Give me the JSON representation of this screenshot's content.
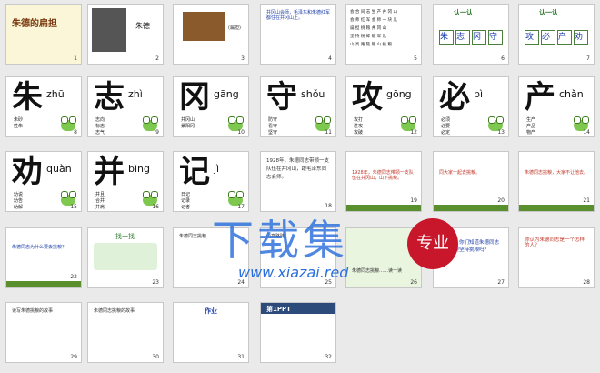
{
  "slides": [
    {
      "n": "1",
      "title": "朱德的扁担"
    },
    {
      "n": "2",
      "caption": "朱德"
    },
    {
      "n": "3",
      "tag": "(扁担)"
    },
    {
      "n": "4",
      "q": "井冈山会师，毛泽东和朱德红军都住在井冈山上。"
    },
    {
      "n": "5",
      "rows": [
        "会 合  同 志  生 产  井 冈 山",
        "会 师  红 军  会 师  一 块 儿",
        "扁 担  挑 粮  井 冈 山",
        "坚 持  粉 碎  敌 军 队",
        "山 高 路 陡  敌 山 挑 粮"
      ]
    },
    {
      "n": "6",
      "head": "认一认",
      "chars": [
        "朱",
        "志",
        "冈",
        "守"
      ]
    },
    {
      "n": "7",
      "head": "认一认",
      "chars": [
        "攻",
        "必",
        "产",
        "劝"
      ]
    },
    {
      "n": "8",
      "char": "朱",
      "pinyin": "zhū",
      "words": "朱砂\n姓朱"
    },
    {
      "n": "9",
      "char": "志",
      "pinyin": "zhì",
      "words": "志向\n标志\n志气"
    },
    {
      "n": "10",
      "char": "冈",
      "pinyin": "gāng",
      "words": "井冈山\n景阳冈"
    },
    {
      "n": "11",
      "char": "守",
      "pinyin": "shǒu",
      "words": "防守\n看守\n坚守"
    },
    {
      "n": "12",
      "char": "攻",
      "pinyin": "gōng",
      "words": "攻打\n进攻\n攻破"
    },
    {
      "n": "13",
      "char": "必",
      "pinyin": "bì",
      "words": "必须\n必要\n必定"
    },
    {
      "n": "14",
      "char": "产",
      "pinyin": "chǎn",
      "words": "生产\n产品\n物产"
    },
    {
      "n": "15",
      "char": "劝",
      "pinyin": "quàn",
      "words": "劝说\n劝告\n劝解"
    },
    {
      "n": "16",
      "char": "并",
      "pinyin": "bìng",
      "words": "并且\n合并\n并肩"
    },
    {
      "n": "17",
      "char": "记",
      "pinyin": "jì",
      "words": "日记\n记录\n记者"
    },
    {
      "n": "18",
      "text": "1928年，朱德同志带领一支队伍在井冈山，跟毛泽东同志会师。"
    },
    {
      "n": "19",
      "text": "1928年，朱德同志带领一支队伍在井冈山，山下挑粮。"
    },
    {
      "n": "20",
      "text": "同大家一起去挑粮。"
    },
    {
      "n": "21",
      "text": "朱德同志挑粮，大家不让他去。"
    },
    {
      "n": "22",
      "text": "朱德同志为什么要去挑粮？"
    },
    {
      "n": "23",
      "head": "找一找"
    },
    {
      "n": "24",
      "text": "朱德同志挑粮……"
    },
    {
      "n": "25",
      "text": "山高路陡"
    },
    {
      "n": "26",
      "text": "朱德同志挑粮……读一读"
    },
    {
      "n": "27",
      "text": "同学们，你们知道朱德同志为什么要坚持挑粮吗？"
    },
    {
      "n": "28",
      "text": "你认为朱德同志是一个怎样的人？"
    },
    {
      "n": "29",
      "text": "读写朱德挑粮的故事"
    },
    {
      "n": "30",
      "text": "朱德同志挑粮的故事"
    },
    {
      "n": "31",
      "head": "作业"
    },
    {
      "n": "32",
      "head": "第1PPT"
    }
  ],
  "watermark": {
    "cn": "下载集",
    "badge": "专业",
    "url": "www.xiazai.red"
  }
}
